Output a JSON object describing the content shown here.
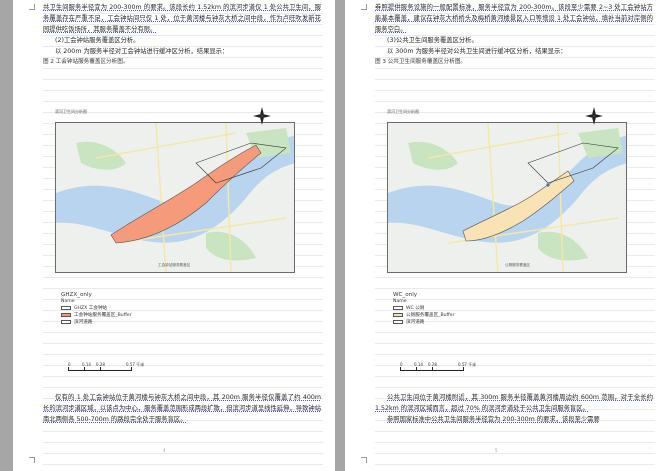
{
  "left_page": {
    "top_lines": [
      "共卫生间服务半径宜为 200-300m 的要求。该段长约 1.52km 的滨河步道仅 1 处公共卫生间，服务覆盖存在严重不足，工会钟站间只仅 1 处，位于黄河楼与钟灰大桥之间中段，作为卢旺吹发新花园提供吃饭场所，其服务覆盖不分有限。",
      "(2)工会钟站服务覆盖区分析。",
      "以 200m 为服务半径对工会钟站进行缓冲区分析，结果显示：",
      "图 2 工会钟站服务覆盖区分析图。"
    ],
    "map_title": "滨河卫生间分析图",
    "map_label": "工会钟站服务覆盖区",
    "legend": {
      "title": "GHZX_only",
      "name_label": "Name",
      "items": [
        {
          "label": "GHZX 工会钟站",
          "color": "#ffffff"
        },
        {
          "label": "工会钟站服务覆盖区_Buffer",
          "color": "#f59a7a"
        },
        {
          "label": "滨河道路",
          "color": "#ffffff"
        }
      ]
    },
    "scale": {
      "t0": "0",
      "t1": "0.14",
      "t2": "0.28",
      "t3": "0.57 千米"
    },
    "bottom_lines": [
      "仅有的 1 处工会钟站位于黄河楼与钟灰大桥之间中段，其 200m 服务半径仅覆盖了约 400m 长的滨河步道区域，以该点为中心，服务覆盖范围形成两段扩散，但滨河步道呈线性延伸，导致钟站南北两侧各 500-700m 的路段完全处于服务盲区。"
    ],
    "page_number": "4"
  },
  "right_page": {
    "top_lines": [
      "券照提供服务设施的一般配置标准，服务半径宜为 200-300m。该段至少需要 2~3 处工会钟站方能基本覆盖，建议在钟灰大桥桥头及梅桥黄河楼景区入口等增设 1 处工会钟站，填补当前对岸侧的服务空白。",
      "(3)公共卫生间服务覆盖区分析。",
      "以 300m 为服务半径对公共卫生间进行缓冲区分析，结果显示：",
      "图 3 公共卫生间服务覆盖区分析图。"
    ],
    "map_title": "滨河卫生间分析图",
    "map_label": "公厕服务覆盖区",
    "legend": {
      "title": "WC_only",
      "name_label": "Name",
      "items": [
        {
          "label": "WC 公厕",
          "color": "#ffffff"
        },
        {
          "label": "公厕服务覆盖区_Buffer",
          "color": "#f9e2b4"
        },
        {
          "label": "滨河道路",
          "color": "#ffffff"
        }
      ]
    },
    "scale": {
      "t0": "0",
      "t1": "0.14",
      "t2": "0.28",
      "t3": "0.57 千米"
    },
    "bottom_lines": [
      "公共卫生间位于黄河楼附近，其 300m 服务半径覆盖黄河楼周边约 600m 范围，对于全长约 1.52km 的滨河区域而言，超过 70% 的滨河步道处于公共卫生间服务盲区。",
      "参照国家标准中公共卫生间服务半径宜为 200-300m 的要求，该段至少需要"
    ],
    "page_number": "5"
  },
  "colors": {
    "water": "#b9d4ef",
    "land": "#eef0ee",
    "green": "#c9e4c1",
    "buffer_left": "#f59a7a",
    "buffer_right": "#f9e2b4"
  }
}
